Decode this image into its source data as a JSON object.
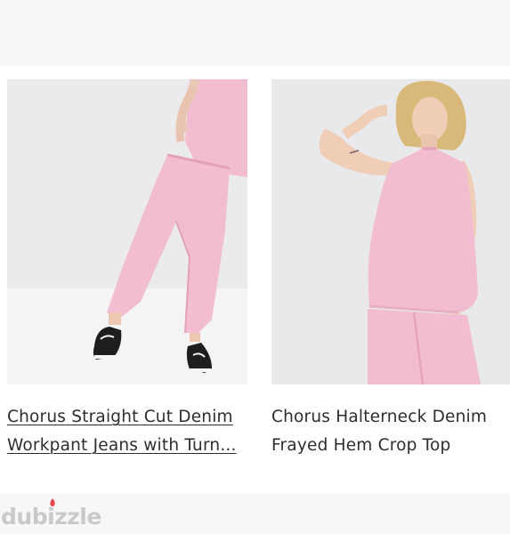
{
  "products": [
    {
      "title": "Chorus Straight Cut Denim Workpant Jeans with Turn...",
      "image_alt": "pink straight cut jeans with black sneakers"
    },
    {
      "title": "Chorus Halterneck Denim Frayed Hem Crop Top",
      "image_alt": "pink halterneck top"
    }
  ],
  "watermark": "dubizzle",
  "colors": {
    "pink": "#f2bdd0",
    "pink_shadow": "#e4a0b9",
    "background": "#ececef",
    "watermark": "#c9c9c9",
    "accent_flame": "#e8464d"
  }
}
